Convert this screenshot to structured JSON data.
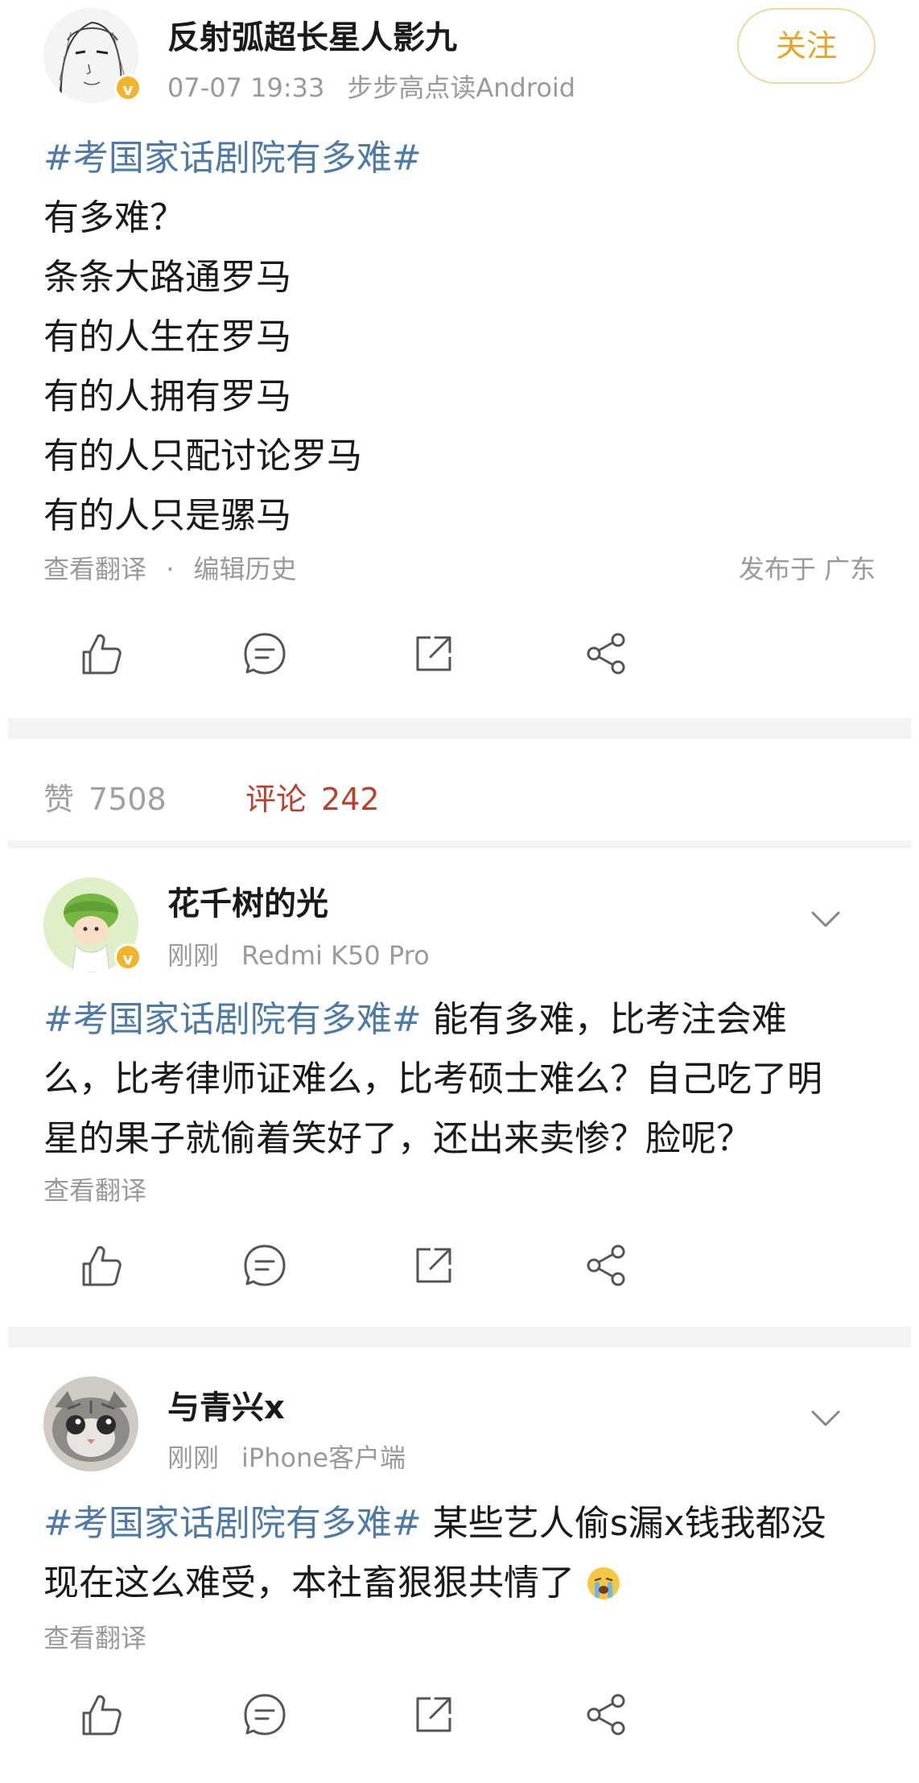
{
  "post": {
    "username": "反射弧超长星人影九",
    "time": "07-07 19:33",
    "source": "步步高点读Android",
    "follow_label": "关注",
    "hashtag": "#考国家话剧院有多难#",
    "lines": [
      "有多难？",
      "条条大路通罗马",
      "有的人生在罗马",
      "有的人拥有罗马",
      "有的人只配讨论罗马",
      "有的人只是骡马"
    ],
    "translate": "查看翻译",
    "separator": "·",
    "edit_history": "编辑历史",
    "location": "发布于 广东"
  },
  "stats": {
    "likes_label": "赞",
    "likes_count": "7508",
    "comments_label": "评论",
    "comments_count": "242"
  },
  "comments": [
    {
      "username": "花千树的光",
      "time": "刚刚",
      "device": "Redmi K50 Pro",
      "hashtag": "#考国家话剧院有多难#",
      "line1_rest": " 能有多难，比考注会难",
      "line2": "么，比考律师证难么，比考硕士难么？自己吃了明",
      "line3": "星的果子就偷着笑好了，还出来卖惨？脸呢？",
      "translate": "查看翻译"
    },
    {
      "username": "与青兴x",
      "time": "刚刚",
      "device": "iPhone客户端",
      "hashtag": "#考国家话剧院有多难#",
      "line1_rest": " 某些艺人偷s漏x钱我都没",
      "line2": "现在这么难受，本社畜狠狠共情了",
      "translate": "查看翻译"
    }
  ],
  "colors": {
    "hashtag": "#4f7aa6",
    "follow": "#e2a52a",
    "comments": "#b7402e",
    "verified": "#f2b42c"
  }
}
